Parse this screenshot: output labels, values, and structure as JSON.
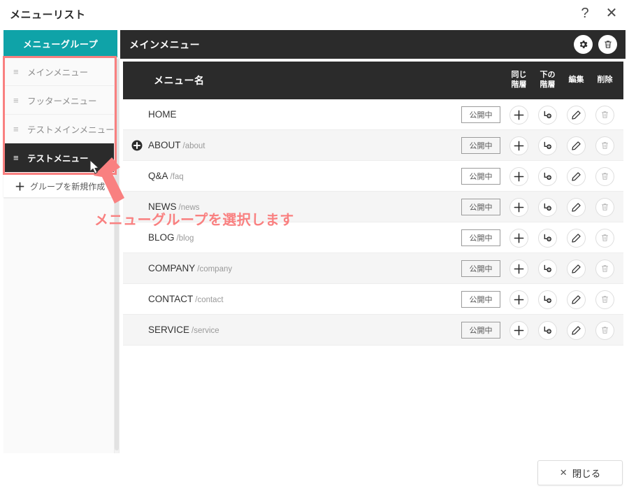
{
  "modal": {
    "title": "メニューリスト",
    "help_icon": "?",
    "close_icon": "✕"
  },
  "sidebar": {
    "tab_label": "メニューグループ",
    "hamburger_icon": "≡",
    "items": [
      {
        "label": "メインメニュー",
        "selected": false
      },
      {
        "label": "フッターメニュー",
        "selected": false
      },
      {
        "label": "テストメインメニュー",
        "selected": false
      },
      {
        "label": "テストメニュー",
        "selected": true
      }
    ],
    "new_group_label": "グループを新規作成",
    "new_group_plus": "＋"
  },
  "panel": {
    "header_title": "メインメニュー",
    "settings_icon": "gear-icon",
    "delete_icon": "trash-icon"
  },
  "table": {
    "col_name": "メニュー名",
    "col_same_level_l1": "同じ",
    "col_same_level_l2": "階層",
    "col_sub_level_l1": "下の",
    "col_sub_level_l2": "階層",
    "col_edit": "編集",
    "col_delete": "削除",
    "status_label": "公開中",
    "rows": [
      {
        "name": "HOME",
        "path": "",
        "expandable": false
      },
      {
        "name": "ABOUT",
        "path": "/about",
        "expandable": true
      },
      {
        "name": "Q&A",
        "path": "/faq",
        "expandable": false
      },
      {
        "name": "NEWS",
        "path": "/news",
        "expandable": false
      },
      {
        "name": "BLOG",
        "path": "/blog",
        "expandable": false
      },
      {
        "name": "COMPANY",
        "path": "/company",
        "expandable": false
      },
      {
        "name": "CONTACT",
        "path": "/contact",
        "expandable": false
      },
      {
        "name": "SERVICE",
        "path": "/service",
        "expandable": false
      }
    ]
  },
  "footer": {
    "close_label": "閉じる",
    "close_icon": "✕"
  },
  "annotation": {
    "text": "メニューグループを選択します",
    "color": "#f98080"
  },
  "colors": {
    "accent_teal": "#0fa3a8",
    "dark": "#2b2b2b",
    "annotation": "#f98080",
    "row_alt": "#f5f5f5"
  }
}
